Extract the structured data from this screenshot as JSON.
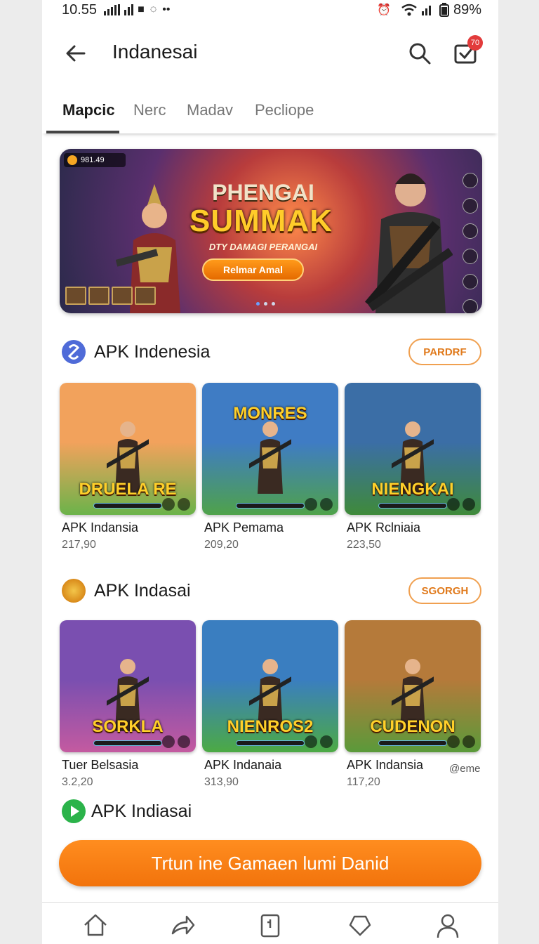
{
  "status": {
    "time": "10.55",
    "battery": "89%"
  },
  "header": {
    "title": "Indanesai",
    "cart_badge": "70"
  },
  "tabs": [
    {
      "label": "Mapcic",
      "active": true
    },
    {
      "label": "Nerc"
    },
    {
      "label": "Madav"
    },
    {
      "label": "Pecliope"
    }
  ],
  "banner": {
    "hud_text": "981.49",
    "title_line1": "PHENGAI",
    "title_line2": "SUMMAK",
    "subtitle": "DTY DAMAGI PERANGAI",
    "cta": "Relmar Amal"
  },
  "sections": [
    {
      "title": "APK Indenesia",
      "button": "PARDRF",
      "icon_color": "#4f6bd8",
      "items": [
        {
          "name": "APK Indansia",
          "meta": "217,90",
          "art_text": "DRUELA RE",
          "colors": [
            "#f2a25c",
            "#6bb34a"
          ]
        },
        {
          "name": "APK Pemama",
          "meta": "209,20",
          "art_text": "MONRES",
          "colors": [
            "#3f7cc4",
            "#4fa24a"
          ]
        },
        {
          "name": "APK Rclniaia",
          "meta": "223,50",
          "art_text": "NIENGKAI",
          "colors": [
            "#3b6ea6",
            "#3f8a3a"
          ]
        }
      ]
    },
    {
      "title": "APK Indasai",
      "button": "SGORGH",
      "icon_color": "#d98a1a",
      "items": [
        {
          "name": "Tuer Belsasia",
          "meta": "3.2,20",
          "art_text": "SORKLA",
          "colors": [
            "#7a4fb0",
            "#c45aa0"
          ]
        },
        {
          "name": "APK Indanaia",
          "meta": "313,90",
          "art_text": "NIENROS2",
          "colors": [
            "#3a7ec0",
            "#4caa44"
          ]
        },
        {
          "name": "APK Indansia",
          "meta": "117,20",
          "art_text": "CUDENON",
          "colors": [
            "#b57a3a",
            "#5a9a3a"
          ]
        }
      ]
    }
  ],
  "extra_meta": "@eme",
  "section3": {
    "title": "APK Indiasai",
    "icon_color": "#2bb34a"
  },
  "cta": {
    "label": "Trtun ine Gamaen lumi Danid"
  },
  "accent": "#f2730c"
}
